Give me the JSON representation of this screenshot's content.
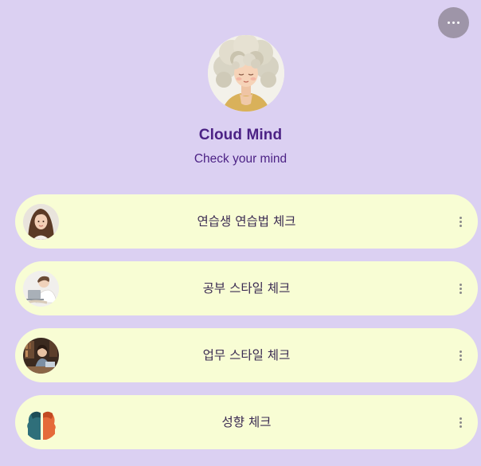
{
  "header": {
    "more_button_icon": "more-horizontal-icon"
  },
  "profile": {
    "name": "Cloud Mind",
    "tagline": "Check your mind",
    "avatar_icon": "cloud-hair-girl-illustration"
  },
  "links": [
    {
      "label": "연습생 연습법 체크",
      "thumbnail": "woman-portrait"
    },
    {
      "label": "공부 스타일 체크",
      "thumbnail": "student-at-laptop"
    },
    {
      "label": "업무 스타일 체크",
      "thumbnail": "woman-working-at-desk"
    },
    {
      "label": "성향 체크",
      "thumbnail": "two-face-profiles"
    }
  ],
  "colors": {
    "background": "#dbd0f2",
    "card": "#f8fdd4",
    "title": "#4c2285",
    "menu_button": "#9e95a8"
  }
}
